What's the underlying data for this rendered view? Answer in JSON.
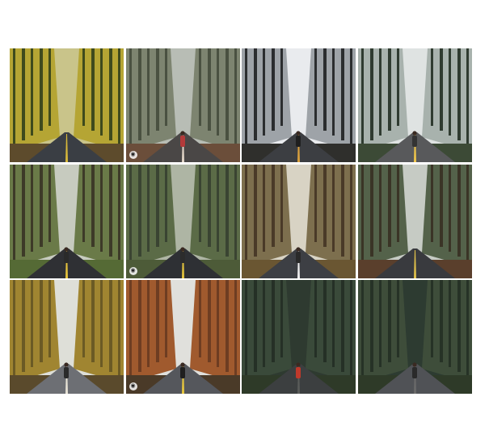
{
  "grid": {
    "photos": [
      {
        "subject": "forest-road",
        "palette": {
          "sky": "#c9c48a",
          "trees": "#3e4a1d",
          "canopy": "#b5a534",
          "road": "#3a3e44",
          "line": "#d8b93a",
          "ground": "#5d4b2c"
        },
        "has_person": false,
        "badge": ""
      },
      {
        "subject": "forest-road",
        "palette": {
          "sky": "#b8bdb5",
          "trees": "#4a5141",
          "canopy": "#7d8470",
          "road": "#4a4746",
          "line": "#e3d6c8",
          "ground": "#6b4e3a"
        },
        "has_person": true,
        "person_color": "#b33a3a",
        "badge": "◉"
      },
      {
        "subject": "foggy-road",
        "palette": {
          "sky": "#e9ebee",
          "trees": "#2b2d2f",
          "canopy": "#9ea3a8",
          "road": "#3c3e42",
          "line": "#d9a03d",
          "ground": "#2f2f2c"
        },
        "has_person": true,
        "person_color": "#1f1f1f",
        "badge": ""
      },
      {
        "subject": "foggy-road",
        "palette": {
          "sky": "#dfe3e2",
          "trees": "#2f3b30",
          "canopy": "#a8b2ad",
          "road": "#58595b",
          "line": "#f0c64a",
          "ground": "#3c4a36"
        },
        "has_person": true,
        "person_color": "#333",
        "badge": ""
      },
      {
        "subject": "redwood-road",
        "palette": {
          "sky": "#c7cbbf",
          "trees": "#3d3a28",
          "canopy": "#6a7a48",
          "road": "#2f3034",
          "line": "#e5c23b",
          "ground": "#556a35"
        },
        "has_person": true,
        "person_color": "#2a2a2a",
        "badge": ""
      },
      {
        "subject": "redwood-road",
        "palette": {
          "sky": "#aeb5a4",
          "trees": "#3a4432",
          "canopy": "#5b6b47",
          "road": "#2e3034",
          "line": "#e3c33d",
          "ground": "#4d5b38"
        },
        "has_person": true,
        "person_color": "#2c2c2c",
        "badge": "◉"
      },
      {
        "subject": "redwood-road",
        "palette": {
          "sky": "#d8d3c4",
          "trees": "#4a3a28",
          "canopy": "#7d6f4e",
          "road": "#3d3f44",
          "line": "#eeeeee",
          "ground": "#6a5632"
        },
        "has_person": true,
        "person_color": "#2a2a2a",
        "badge": ""
      },
      {
        "subject": "redwood-road",
        "palette": {
          "sky": "#c6cbc4",
          "trees": "#3a3426",
          "canopy": "#54624a",
          "road": "#393a3e",
          "line": "#e0c04a",
          "ground": "#5a3f2c"
        },
        "has_person": false,
        "badge": ""
      },
      {
        "subject": "autumn-road",
        "palette": {
          "sky": "#dedfd8",
          "trees": "#6b5a25",
          "canopy": "#a08531",
          "road": "#6d6f74",
          "line": "#e8e3d6",
          "ground": "#5a4a2c"
        },
        "has_person": true,
        "person_color": "#2a2a2a",
        "badge": ""
      },
      {
        "subject": "autumn-road",
        "palette": {
          "sky": "#e0e0dc",
          "trees": "#6e3d22",
          "canopy": "#a05a2e",
          "road": "#55575c",
          "line": "#e9c83d",
          "ground": "#4a3a28"
        },
        "has_person": true,
        "person_color": "#1f1f1f",
        "badge": "◉"
      },
      {
        "subject": "wet-road",
        "palette": {
          "sky": "#2e3a30",
          "trees": "#253026",
          "canopy": "#3a4a3a",
          "road": "#3c3f40",
          "line": "#5a5c5a",
          "ground": "#2e3a28"
        },
        "has_person": true,
        "person_color": "#c0392b",
        "badge": ""
      },
      {
        "subject": "wet-road",
        "palette": {
          "sky": "#2d3b31",
          "trees": "#263226",
          "canopy": "#3e4d3a",
          "road": "#505256",
          "line": "#6a6a6a",
          "ground": "#2e3a28"
        },
        "has_person": true,
        "person_color": "#2a2a2a",
        "badge": ""
      }
    ]
  }
}
